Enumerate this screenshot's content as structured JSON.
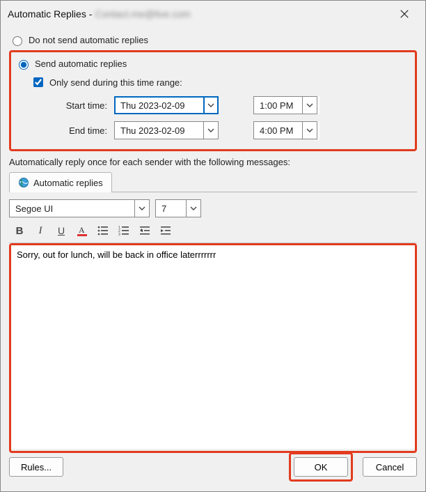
{
  "titlebar": {
    "prefix": "Automatic Replies - ",
    "email": "Contact.me@live.com"
  },
  "radios": {
    "dont_send": "Do not send automatic replies",
    "send": "Send automatic replies"
  },
  "checkbox": {
    "only_during": "Only send during this time range:"
  },
  "labels": {
    "start_time": "Start time:",
    "end_time": "End time:",
    "auto_reply_section": "Automatically reply once for each sender with the following messages:"
  },
  "times": {
    "start_date": "Thu 2023-02-09",
    "start_time": "1:00 PM",
    "end_date": "Thu 2023-02-09",
    "end_time": "4:00 PM"
  },
  "tab": {
    "label": "Automatic replies"
  },
  "font": {
    "name": "Segoe UI",
    "size": "7"
  },
  "editor": {
    "text": "Sorry, out for lunch, will be back in office laterrrrrrr"
  },
  "buttons": {
    "rules": "Rules...",
    "ok": "OK",
    "cancel": "Cancel"
  }
}
